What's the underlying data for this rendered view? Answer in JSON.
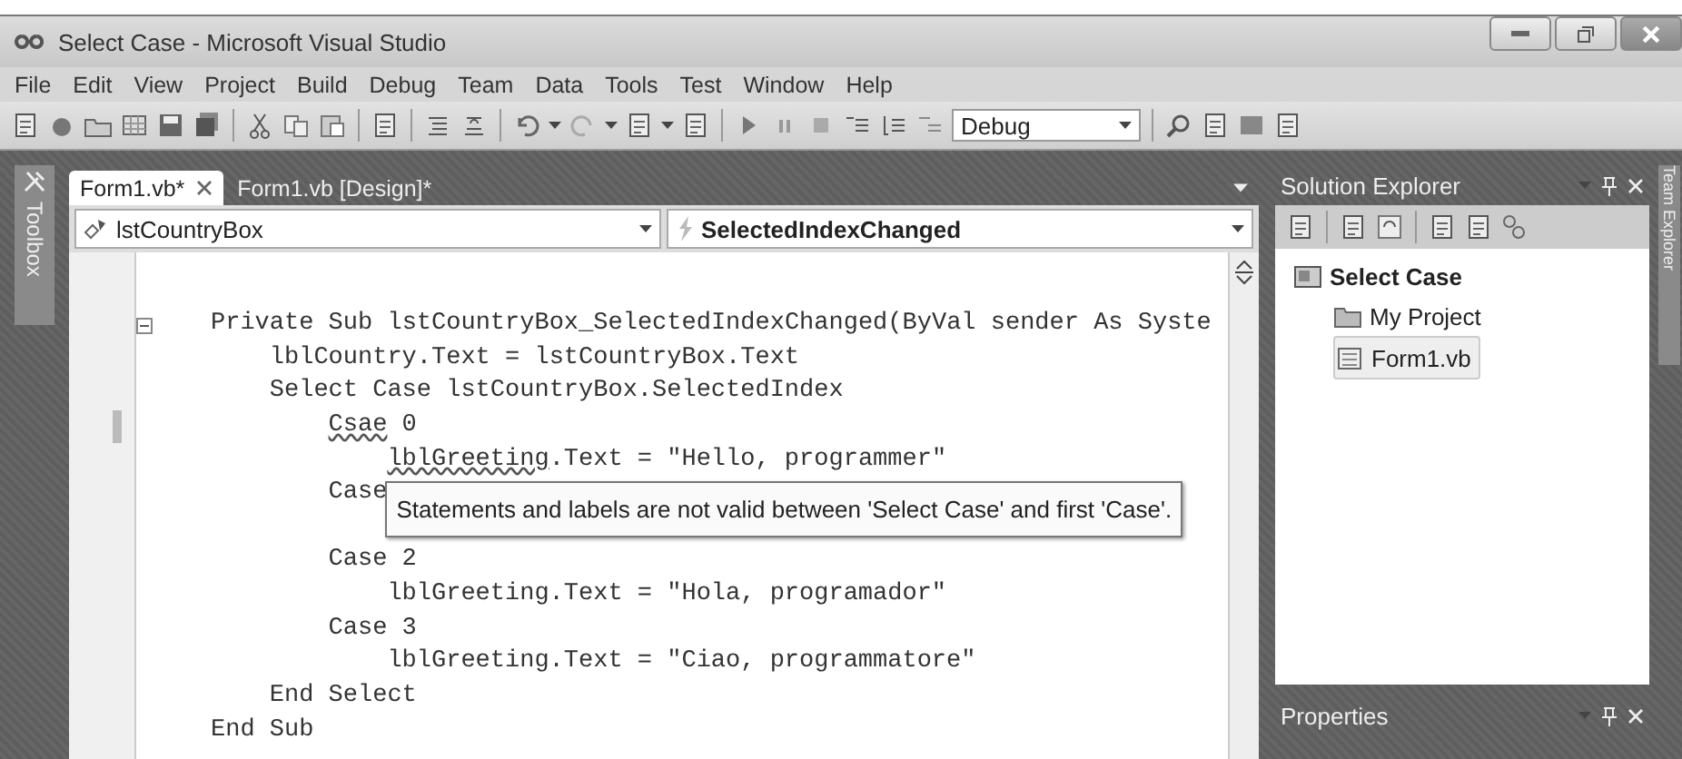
{
  "window": {
    "title": "Select Case - Microsoft Visual Studio"
  },
  "menu": [
    "File",
    "Edit",
    "View",
    "Project",
    "Build",
    "Debug",
    "Team",
    "Data",
    "Tools",
    "Test",
    "Window",
    "Help"
  ],
  "toolbar": {
    "configuration": "Debug"
  },
  "toolbox": {
    "label": "Toolbox"
  },
  "editor_tabs": [
    {
      "label": "Form1.vb*",
      "selected": true
    },
    {
      "label": "Form1.vb [Design]*",
      "selected": false
    }
  ],
  "class_dropdown": "lstCountryBox",
  "method_dropdown": "SelectedIndexChanged",
  "code": [
    {
      "kind": "line",
      "segments": [
        {
          "text": "Private Sub lstCountryBox_SelectedIndexChanged(ByVal sender As Syste",
          "error": false
        }
      ],
      "collapsible": true,
      "modified": false,
      "children": [
        {
          "kind": "line",
          "segments": [
            {
              "text": "lblCountry.Text = lstCountryBox.Text",
              "error": false
            }
          ],
          "collapsible": false,
          "modified": false
        },
        {
          "kind": "line",
          "segments": [
            {
              "text": "Select Case lstCountryBox.SelectedIndex",
              "error": false
            }
          ],
          "collapsible": false,
          "modified": false,
          "children": [
            {
              "kind": "line",
              "segments": [
                {
                  "text": "Csae",
                  "error": true
                },
                {
                  "text": " 0",
                  "error": false
                }
              ],
              "collapsible": false,
              "modified": true,
              "children": [
                {
                  "kind": "line",
                  "segments": [
                    {
                      "text": "lblGreeting",
                      "error": true
                    },
                    {
                      "text": ".Text = \"Hello, programmer\"",
                      "error": false
                    }
                  ],
                  "collapsible": false,
                  "modified": false
                }
              ]
            },
            {
              "kind": "line",
              "segments": [
                {
                  "text": "Case",
                  "error": false
                }
              ],
              "collapsible": false,
              "modified": false,
              "children": [
                {
                  "kind": "tooltip",
                  "text": "Statements and labels are not valid between 'Select Case' and first 'Case'."
                }
              ]
            },
            {
              "kind": "line",
              "segments": [
                {
                  "text": "Case 2",
                  "error": false
                }
              ],
              "collapsible": false,
              "modified": false,
              "children": [
                {
                  "kind": "line",
                  "segments": [
                    {
                      "text": "lblGreeting.Text = \"Hola, programador\"",
                      "error": false
                    }
                  ],
                  "collapsible": false,
                  "modified": false
                }
              ]
            },
            {
              "kind": "line",
              "segments": [
                {
                  "text": "Case 3",
                  "error": false
                }
              ],
              "collapsible": false,
              "modified": false,
              "children": [
                {
                  "kind": "line",
                  "segments": [
                    {
                      "text": "lblGreeting.Text = \"Ciao, programmatore\"",
                      "error": false
                    }
                  ],
                  "collapsible": false,
                  "modified": false
                }
              ]
            }
          ]
        },
        {
          "kind": "line",
          "segments": [
            {
              "text": "End Select",
              "error": false
            }
          ],
          "collapsible": false,
          "modified": false
        }
      ]
    },
    {
      "kind": "line",
      "segments": [
        {
          "text": "End Sub",
          "error": false
        }
      ],
      "collapsible": false,
      "modified": false
    }
  ],
  "solution_explorer": {
    "title": "Solution Explorer",
    "tree": [
      {
        "label": "Select Case",
        "kind": "solution",
        "selected": false,
        "children": [
          {
            "label": "My Project",
            "kind": "project",
            "selected": false
          },
          {
            "label": "Form1.vb",
            "kind": "form",
            "selected": true
          }
        ]
      }
    ]
  },
  "properties": {
    "title": "Properties"
  },
  "team_explorer": {
    "label": "Team Explorer"
  }
}
